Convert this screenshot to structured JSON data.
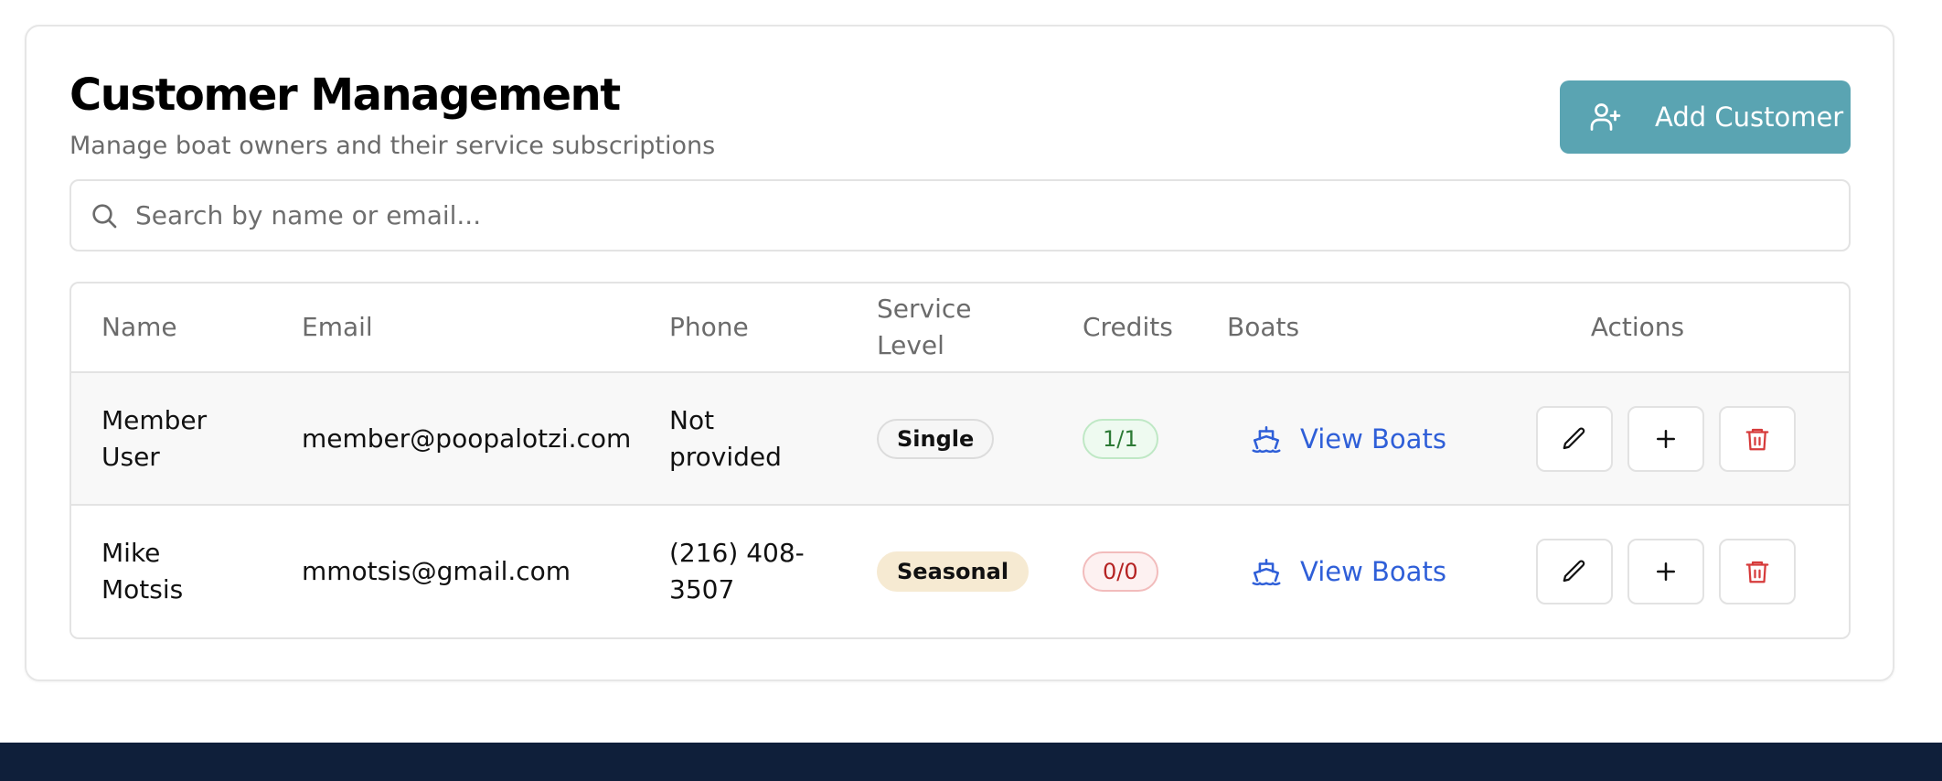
{
  "header": {
    "title": "Customer Management",
    "subtitle": "Manage boat owners and their service subscriptions",
    "add_button_label": "Add Customer",
    "add_button_color": "#5aa4b2"
  },
  "search": {
    "placeholder": "Search by name or email...",
    "value": ""
  },
  "table": {
    "columns": [
      "Name",
      "Email",
      "Phone",
      "Service Level",
      "Credits",
      "Boats",
      "Actions"
    ],
    "rows": [
      {
        "name": "Member User",
        "email": "member@poopalotzi.com",
        "phone": "Not provided",
        "service_level": "Single",
        "credits": "1/1",
        "credits_status": "ok",
        "boats_link": "View Boats"
      },
      {
        "name": "Mike Motsis",
        "email": "mmotsis@gmail.com",
        "phone": "(216) 408-3507",
        "service_level": "Seasonal",
        "credits": "0/0",
        "credits_status": "empty",
        "boats_link": "View Boats"
      }
    ]
  },
  "icons": {
    "search": "search-icon",
    "add_user": "user-plus-icon",
    "boat": "ship-icon",
    "edit": "pencil-icon",
    "add": "plus-icon",
    "delete": "trash-icon"
  },
  "colors": {
    "link": "#2f5fd8",
    "delete": "#d63b3b",
    "footer": "#0f1f3a",
    "credit_ok": "#2c7a35",
    "credit_bad": "#b52323"
  }
}
